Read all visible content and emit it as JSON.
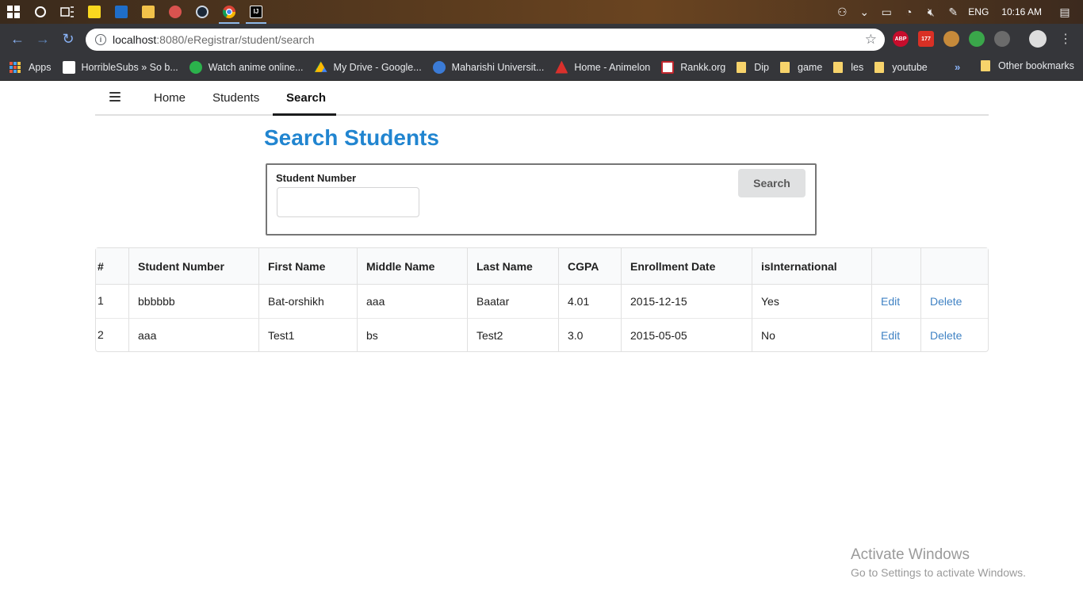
{
  "taskbar": {
    "language": "ENG",
    "time": "10:16 AM"
  },
  "browser": {
    "url_host": "localhost",
    "url_rest": ":8080/eRegistrar/student/search"
  },
  "bookmarks": [
    {
      "label": "Apps",
      "icon": "apps-grid-icon"
    },
    {
      "label": "HorribleSubs » So b...",
      "icon": "horriblesubs-icon"
    },
    {
      "label": "Watch anime online...",
      "icon": "tv-icon"
    },
    {
      "label": "My Drive - Google...",
      "icon": "drive-icon"
    },
    {
      "label": "Maharishi Universit...",
      "icon": "globe-icon"
    },
    {
      "label": "Home - Animelon",
      "icon": "animelon-icon"
    },
    {
      "label": "Rankk.org",
      "icon": "rankk-icon"
    },
    {
      "label": "Dip",
      "icon": "folder-icon"
    },
    {
      "label": "game",
      "icon": "folder-icon"
    },
    {
      "label": "les",
      "icon": "folder-icon"
    },
    {
      "label": "youtube",
      "icon": "folder-icon"
    }
  ],
  "bookmarks_more": "»",
  "bookmarks_other": "Other bookmarks",
  "nav": {
    "home": "Home",
    "students": "Students",
    "search": "Search"
  },
  "page": {
    "title": "Search Students",
    "field_label": "Student Number",
    "field_value": "",
    "search_button": "Search"
  },
  "table": {
    "headers": [
      "#",
      "Student Number",
      "First Name",
      "Middle Name",
      "Last Name",
      "CGPA",
      "Enrollment Date",
      "isInternational",
      "",
      ""
    ],
    "rows": [
      {
        "num": "1",
        "student_number": "bbbbbb",
        "first": "Bat-orshikh",
        "middle": "aaa",
        "last": "Baatar",
        "cgpa": "4.01",
        "date": "2015-12-15",
        "intl": "Yes",
        "edit": "Edit",
        "delete": "Delete"
      },
      {
        "num": "2",
        "student_number": "aaa",
        "first": "Test1",
        "middle": "bs",
        "last": "Test2",
        "cgpa": "3.0",
        "date": "2015-05-05",
        "intl": "No",
        "edit": "Edit",
        "delete": "Delete"
      }
    ]
  },
  "watermark": {
    "line1": "Activate Windows",
    "line2": "Go to Settings to activate Windows."
  },
  "colors": {
    "title_blue": "#2185d0",
    "link_blue": "#4183c4"
  }
}
